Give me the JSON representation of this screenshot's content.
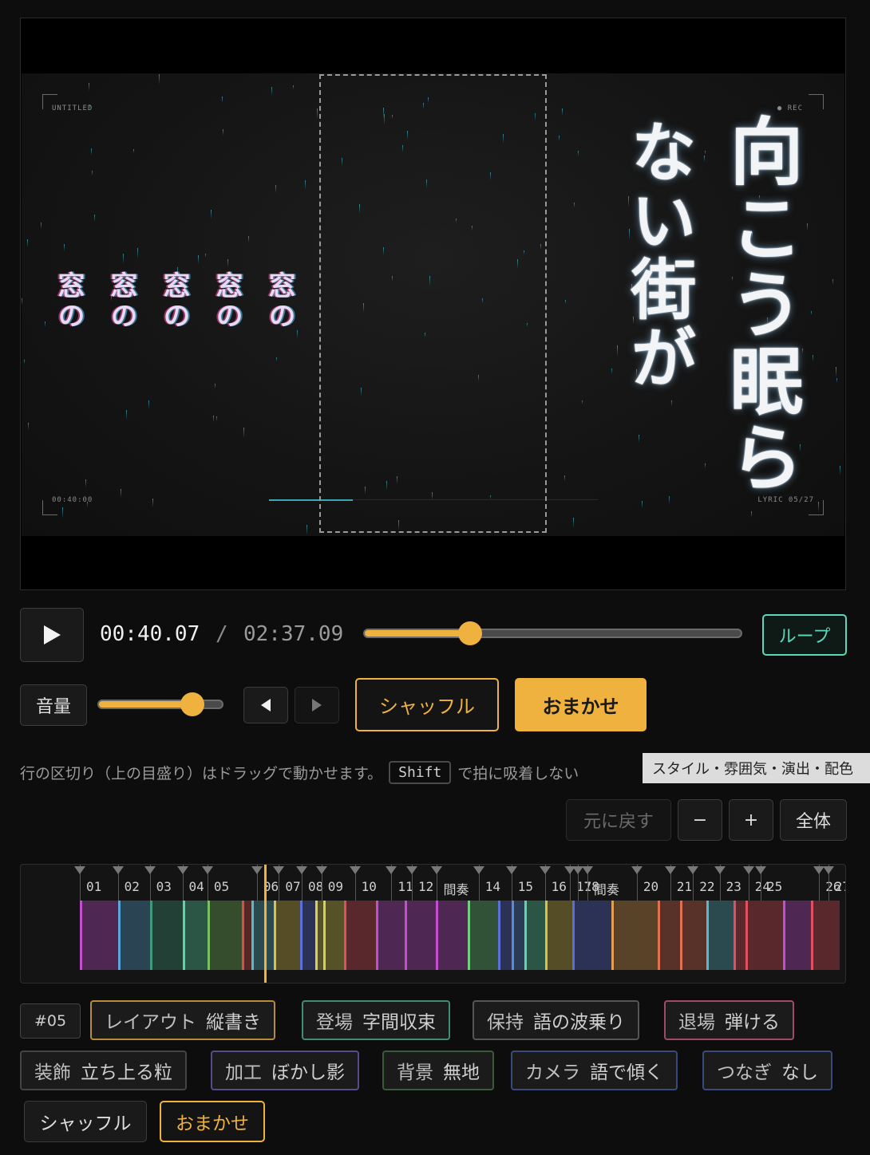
{
  "player": {
    "hud_title": "UNTITLED",
    "hud_rec": "● REC",
    "hud_time": "00:40:00",
    "hud_lyric": "LYRIC 05/27",
    "lyric_main": "向こう眠ら",
    "lyric_sub": "ない街が",
    "lyric_echo": [
      "窓の",
      "窓の",
      "窓の",
      "窓の",
      "窓の"
    ]
  },
  "transport": {
    "play_icon": "play-icon",
    "current_time": "00:40.07",
    "separator": "/",
    "total_time": "02:37.09",
    "progress": 0.28,
    "loop_label": "ループ"
  },
  "audio": {
    "volume_label": "音量",
    "volume": 0.76,
    "prev_icon": "triangle-left-icon",
    "next_icon": "triangle-right-icon",
    "shuffle_label": "シャッフル",
    "auto_label": "おまかせ"
  },
  "hint": {
    "text_before": "行の区切り（上の目盛り）はドラッグで動かせます。",
    "key": "Shift",
    "text_after": "で拍に吸着しない",
    "tooltip": "スタイル・雰囲気・演出・配色"
  },
  "zoom": {
    "undo_label": "元に戻す",
    "minus_label": "−",
    "plus_label": "+",
    "fit_label": "全体"
  },
  "timeline": {
    "playhead": 0.255,
    "labels": [
      "01",
      "02",
      "03",
      "04",
      "05",
      "06",
      "07",
      "08",
      "09",
      "10",
      "11",
      "12",
      "間奏",
      "14",
      "15",
      "16",
      "17",
      "18",
      "間奏",
      "20",
      "21",
      "22",
      "23",
      "24",
      "25",
      "26",
      "27"
    ],
    "segment_colors": [
      "#c24fd0",
      "#5aa6d6",
      "#3f9a7a",
      "#5ad8a8",
      "#7ac060",
      "#d6504a",
      "#5ab8c8",
      "#d8c04a",
      "#5a70d8",
      "#d8d050",
      "#d8d050",
      "#e05060",
      "#c24fd0",
      "#c24fd0",
      "#c24fd0",
      "#70d080",
      "#5a70d8",
      "#5a8ad8",
      "#5ad8a8",
      "#d8c04a",
      "#5a70d8",
      "#e0a050",
      "#e07050",
      "#e07050",
      "#5ab8c8",
      "#e05060",
      "#e05060",
      "#c24fd0",
      "#e05060"
    ]
  },
  "line_settings": {
    "line_no": "#05",
    "layout": {
      "key": "レイアウト",
      "value": "縦書き",
      "color": "#b88a3a"
    },
    "enter": {
      "key": "登場",
      "value": "字間収束",
      "color": "#3f8c78"
    },
    "hold": {
      "key": "保持",
      "value": "語の波乗り",
      "color": "#555555"
    },
    "exit": {
      "key": "退場",
      "value": "弾ける",
      "color": "#a04a6a"
    },
    "decor": {
      "key": "装飾",
      "value": "立ち上る粒",
      "color": "#444444"
    },
    "process": {
      "key": "加工",
      "value": "ぼかし影",
      "color": "#5a4a8a"
    },
    "background": {
      "key": "背景",
      "value": "無地",
      "color": "#3a5a3a"
    },
    "camera": {
      "key": "カメラ",
      "value": "語で傾く",
      "color": "#3a4a7a"
    },
    "link": {
      "key": "つなぎ",
      "value": "なし",
      "color": "#3a4a7a"
    },
    "shuffle_label": "シャッフル",
    "auto_label": "おまかせ"
  },
  "colors": {
    "accent": "#f0b23e",
    "loop": "#5ad8b8"
  }
}
